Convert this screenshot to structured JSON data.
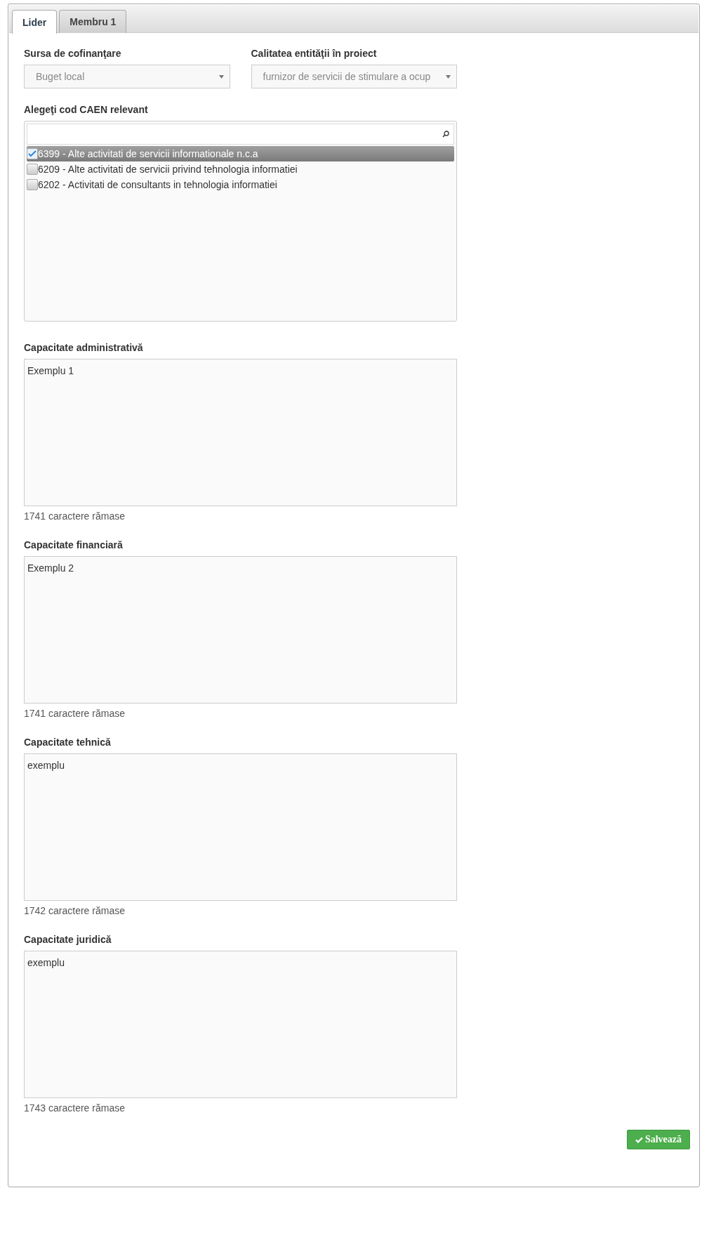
{
  "tabs": [
    {
      "label": "Lider",
      "selected": true
    },
    {
      "label": "Membru 1",
      "selected": false
    }
  ],
  "selects": [
    {
      "label": "Sursa de cofinanţare",
      "value": "Buget local"
    },
    {
      "label": "Calitatea entităţii în proiect",
      "value": "furnizor de servicii de stimulare a ocup"
    }
  ],
  "caen": {
    "label": "Alegeţi cod CAEN relevant",
    "items": [
      {
        "text": "6399 - Alte activitati de servicii informationale n.c.a",
        "checked": true,
        "selected": true
      },
      {
        "text": "6209 - Alte activitati de servicii privind tehnologia informatiei",
        "checked": false,
        "selected": false
      },
      {
        "text": "6202 - Activitati de consultants in tehnologia informatiei",
        "checked": false,
        "selected": false
      }
    ]
  },
  "textareas": [
    {
      "label": "Capacitate administrativă",
      "value": "Exemplu 1",
      "counter": "1741 caractere rămase"
    },
    {
      "label": "Capacitate financiară",
      "value": "Exemplu 2",
      "counter": "1741 caractere rămase"
    },
    {
      "label": "Capacitate tehnică",
      "value": "exemplu",
      "counter": "1742 caractere rămase"
    },
    {
      "label": "Capacitate juridică",
      "value": "exemplu",
      "counter": "1743 caractere rămase"
    }
  ],
  "save_button": "Salvează"
}
